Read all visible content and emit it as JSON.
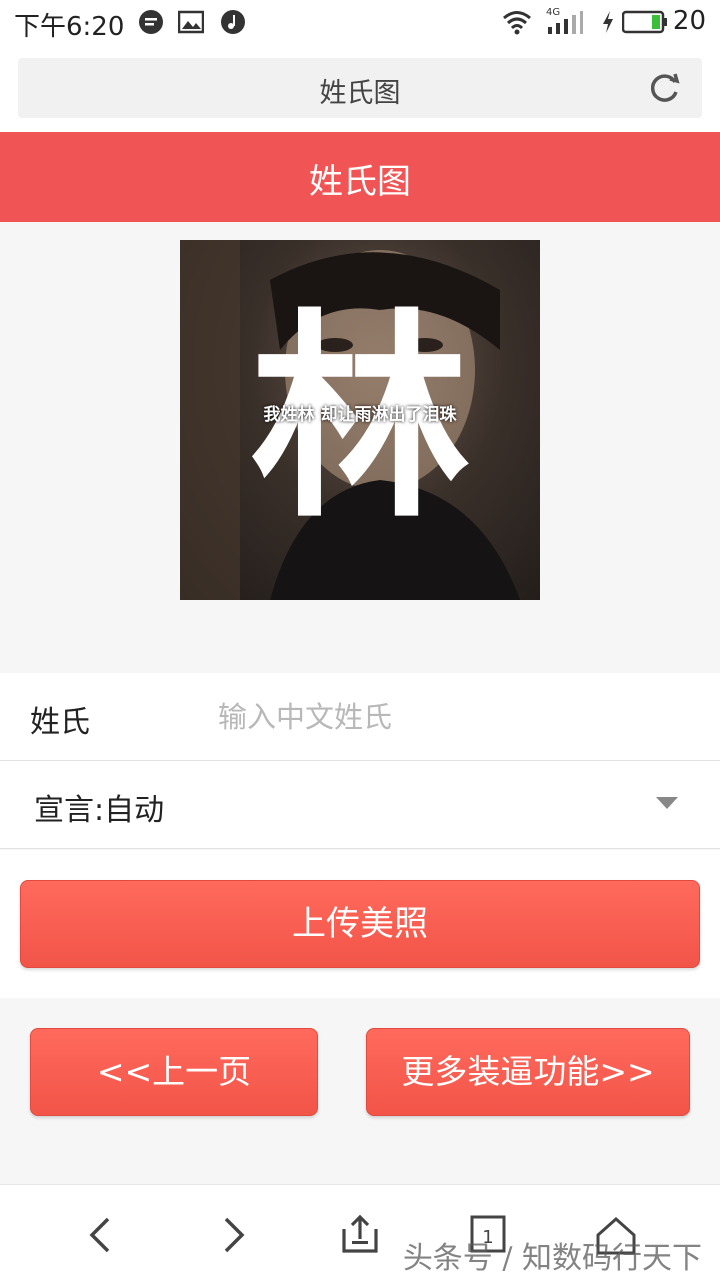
{
  "status_bar": {
    "time": "下午6:20",
    "network": "4G",
    "battery": "20",
    "icons": [
      "message-icon",
      "image-icon",
      "music-icon",
      "wifi-icon",
      "signal-icon",
      "charging-icon",
      "battery-icon"
    ]
  },
  "browser": {
    "page_title": "姓氏图",
    "refresh_icon": "refresh-icon"
  },
  "header": {
    "title": "姓氏图"
  },
  "photo": {
    "big_char": "林",
    "caption": "我姓林 却让雨淋出了泪珠"
  },
  "form": {
    "surname_label": "姓氏",
    "surname_placeholder": "输入中文姓氏",
    "surname_value": "",
    "slogan_label": "宣言:自动"
  },
  "buttons": {
    "upload": "上传美照",
    "prev": "<<上一页",
    "more": "更多装逼功能>>"
  },
  "bottom_nav": {
    "items": [
      "back-icon",
      "forward-icon",
      "share-icon",
      "tabs-icon",
      "home-icon"
    ],
    "tab_count": "1"
  },
  "watermark": "头条号 / 知数码行天下",
  "colors": {
    "header_red": "#f05454",
    "button_red": "#f25448",
    "page_bg": "#f6f6f6"
  }
}
